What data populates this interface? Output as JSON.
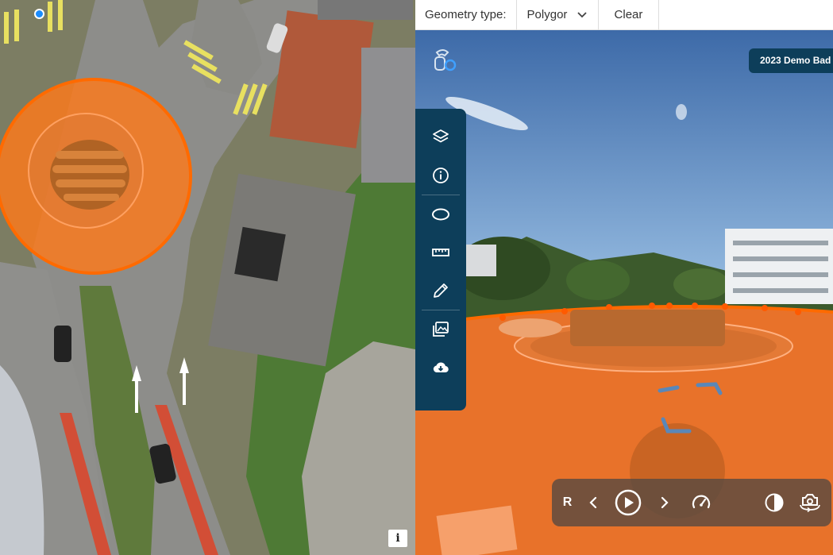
{
  "toolbar": {
    "geometry_label": "Geometry type:",
    "geometry_value": "Polygor",
    "clear_label": "Clear"
  },
  "map": {
    "info_label": "i"
  },
  "viewer": {
    "badge_text": "2023 Demo Bad",
    "playback_r_label": "R"
  },
  "colors": {
    "polygon_fill": "#ff7a1a",
    "sidebar_bg": "#0d3e5a",
    "marker_blue": "#1a8cff"
  },
  "icons": {
    "sidebar": [
      "layers-icon",
      "info-icon",
      "ellipse-icon",
      "ruler-icon",
      "pencil-icon",
      "gallery-icon",
      "cloud-download-icon"
    ],
    "playback": [
      "chevron-left-icon",
      "play-icon",
      "chevron-right-icon",
      "speedometer-icon",
      "contrast-icon",
      "rotate-view-icon"
    ]
  }
}
